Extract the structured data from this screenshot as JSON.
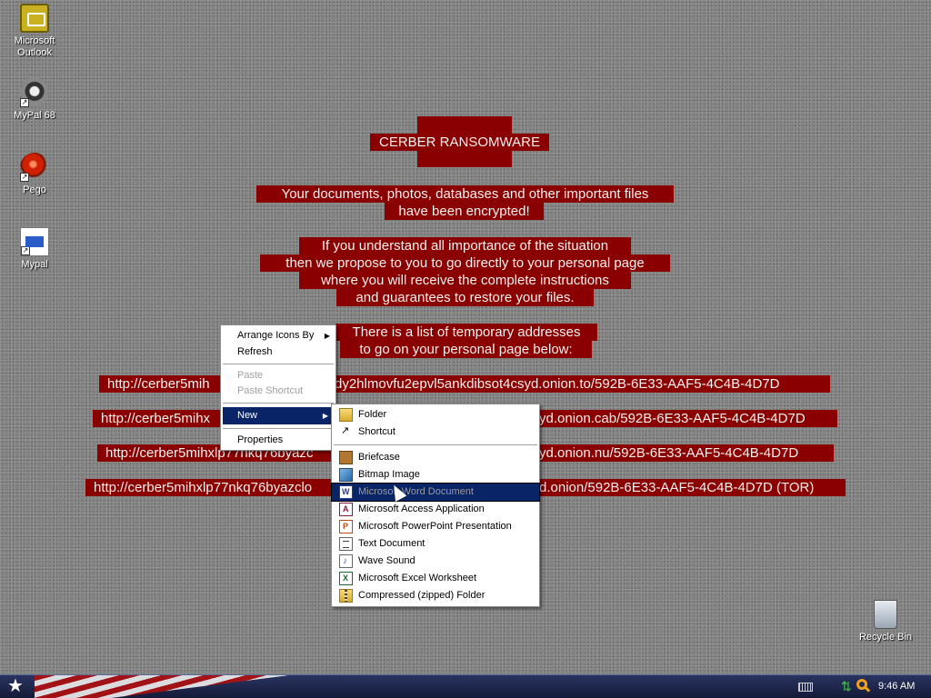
{
  "desktop": {
    "icons": [
      {
        "label": "Microsoft Outlook",
        "icon": "outlook-icon"
      },
      {
        "label": "MyPal 68",
        "icon": "mypal68-icon"
      },
      {
        "label": "Pego",
        "icon": "pego-icon"
      },
      {
        "label": "Mypal",
        "icon": "mypal-icon"
      },
      {
        "label": "Recycle Bin",
        "icon": "recycle-bin-icon"
      }
    ]
  },
  "ransom_note": {
    "title": "CERBER RANSOMWARE",
    "line1": "Your documents, photos, databases and other important files",
    "line2": "have been encrypted!",
    "line3": "If you understand all importance of the situation",
    "line4": "then we propose to you to go directly to your personal page",
    "line5": "where you will receive the complete instructions",
    "line6": "and guarantees to restore your files.",
    "line7": "There is a list of temporary addresses",
    "line8": "to go on your personal page below:",
    "url1_a": "http://cerber5mih",
    "url1_b": "dy2hlmovfu2epvl5ankdibsot4csyd.onion.to/592B-6E33-AAF5-4C4B-4D7D",
    "url2_a": "http://cerber5mihx",
    "url2_b": "yd.onion.cab/592B-6E33-AAF5-4C4B-4D7D",
    "url3_a": "http://cerber5mihxlp77nkq76byazc",
    "url3_b": "yd.onion.nu/592B-6E33-AAF5-4C4B-4D7D",
    "url4_a": "http://cerber5mihxlp77nkq76byazclo",
    "url4_b": "d.onion/592B-6E33-AAF5-4C4B-4D7D (TOR)"
  },
  "context_menu": {
    "arrange_icons": "Arrange Icons By",
    "refresh": "Refresh",
    "paste": "Paste",
    "paste_shortcut": "Paste Shortcut",
    "new": "New",
    "properties": "Properties"
  },
  "new_submenu": {
    "folder": "Folder",
    "shortcut": "Shortcut",
    "briefcase": "Briefcase",
    "bitmap": "Bitmap Image",
    "word": "Microsoft Word Document",
    "access": "Microsoft Access Application",
    "powerpoint": "Microsoft PowerPoint Presentation",
    "text": "Text Document",
    "wave": "Wave Sound",
    "excel": "Microsoft Excel Worksheet",
    "zip": "Compressed (zipped) Folder"
  },
  "taskbar": {
    "clock": "9:46 AM"
  },
  "colors": {
    "note_background": "#8a0000",
    "menu_highlight": "#0a2468",
    "desktop": "#848484"
  }
}
